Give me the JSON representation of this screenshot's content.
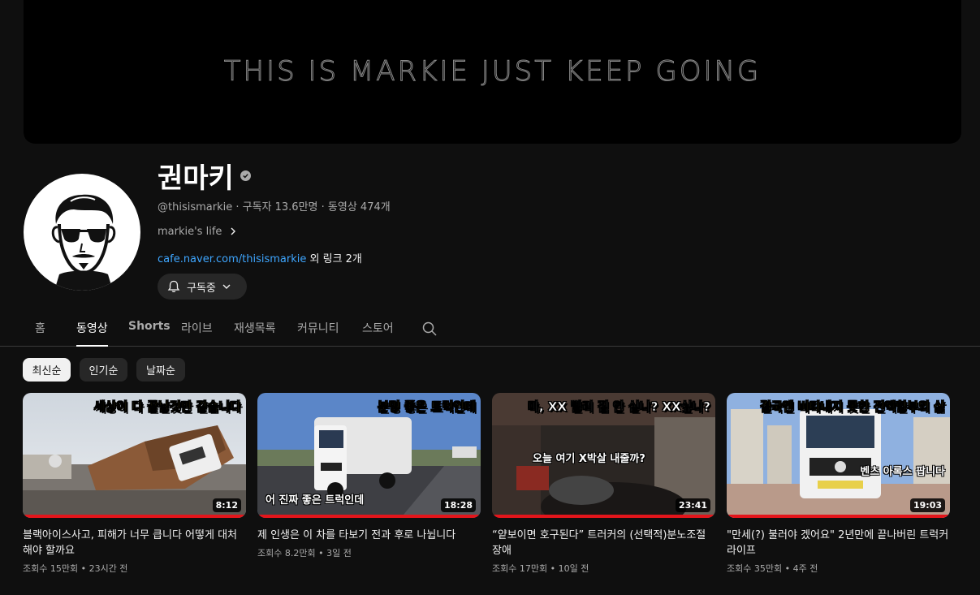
{
  "banner": {
    "text": "THIS IS MARKIE JUST KEEP GOING"
  },
  "channel": {
    "name": "권마키",
    "handle": "@thisismarkie",
    "subscribers": "구독자 13.6만명",
    "video_count": "동영상 474개",
    "description": "markie's life",
    "link": "cafe.naver.com/thisismarkie",
    "more_links": "외 링크 2개",
    "subscribe_label": "구독중"
  },
  "tabs": [
    {
      "label": "홈"
    },
    {
      "label": "동영상",
      "active": true
    },
    {
      "label": "Shorts"
    },
    {
      "label": "라이브"
    },
    {
      "label": "재생목록"
    },
    {
      "label": "커뮤니티"
    },
    {
      "label": "스토어"
    }
  ],
  "chips": [
    {
      "label": "최신순",
      "active": true
    },
    {
      "label": "인기순"
    },
    {
      "label": "날짜순"
    }
  ],
  "videos": [
    {
      "thumb_caption": "세상이 다 끝날것만 같습니다",
      "duration": "8:12",
      "title": "블랙아이스사고, 피해가 너무 큽니다 어떻게 대처해야 할까요",
      "views": "조회수 15만회",
      "age": "23시간 전"
    },
    {
      "thumb_caption": "분명 좋은 트럭인데",
      "thumb_sub": "어 진짜 좋은 트럭인데",
      "duration": "18:28",
      "title": "제 인생은 이 차를 타보기 전과 후로 나뉩니다",
      "views": "조회수 8.2만회",
      "age": "3일 전"
    },
    {
      "thumb_caption": "마, XX 빨리 짐 안 싣나? XX싶나?",
      "thumb_sub": "오늘 여기 X박살 내줄까?",
      "duration": "23:41",
      "title": "“얕보이면 호구된다” 트러커의 (선택적)분노조절장애",
      "views": "조회수 17만회",
      "age": "10일 전"
    },
    {
      "thumb_caption": "결국엔 버티내지 못한 전액할부의 삶",
      "thumb_sub": "벤츠 아록스 팝니다",
      "duration": "19:03",
      "title": "\"만세(?) 불러야 겠어요\" 2년만에 끝나버린 트럭커 라이프",
      "views": "조회수 35만회",
      "age": "4주 전"
    }
  ]
}
